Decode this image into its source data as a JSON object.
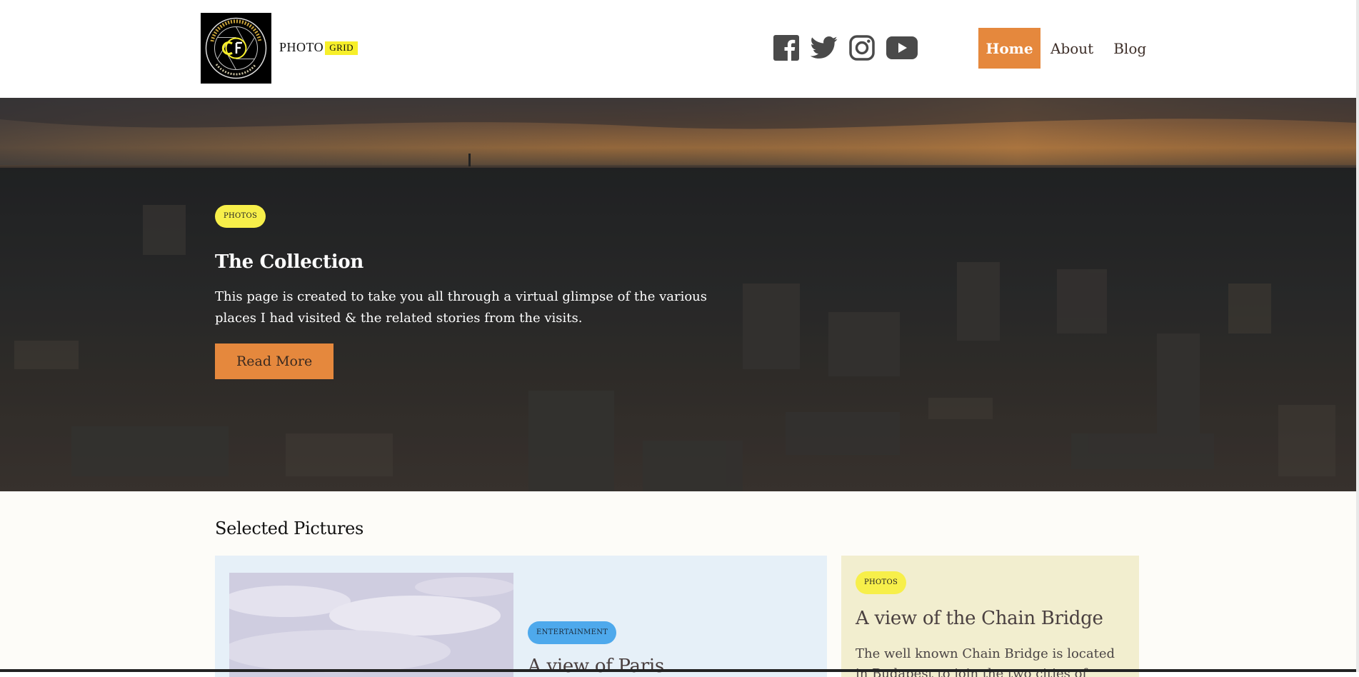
{
  "header": {
    "brand_text": "PHOTO",
    "brand_tag": "GRID",
    "brand_tag_color": "#f7ef2a",
    "socials": [
      {
        "name": "facebook-icon"
      },
      {
        "name": "twitter-icon"
      },
      {
        "name": "instagram-icon"
      },
      {
        "name": "youtube-icon"
      }
    ],
    "nav": [
      {
        "label": "Home",
        "active": true
      },
      {
        "label": "About",
        "active": false
      },
      {
        "label": "Blog",
        "active": false
      }
    ],
    "nav_active_color": "#e5883d"
  },
  "hero": {
    "badge": "PHOTOS",
    "title": "The Collection",
    "description": "This page is created to take you all through a virtual glimpse of the various places I had visited & the related stories from the visits.",
    "button_label": "Read More"
  },
  "selected": {
    "section_title": "Selected Pictures",
    "cards": [
      {
        "badge": "ENTERTAINMENT",
        "title": "A view of Paris",
        "text": ""
      },
      {
        "badge": "PHOTOS",
        "title": "A view of the Chain Bridge",
        "text": "The well known Chain Bridge is located in Budapest to join the two cities of"
      }
    ]
  },
  "colors": {
    "accent": "#e5883d",
    "badge_yellow": "#f7ef4a",
    "badge_blue": "#4ea9ec",
    "card_blue_bg": "#e6f0f8",
    "card_yellow_bg": "#f2eecf"
  }
}
